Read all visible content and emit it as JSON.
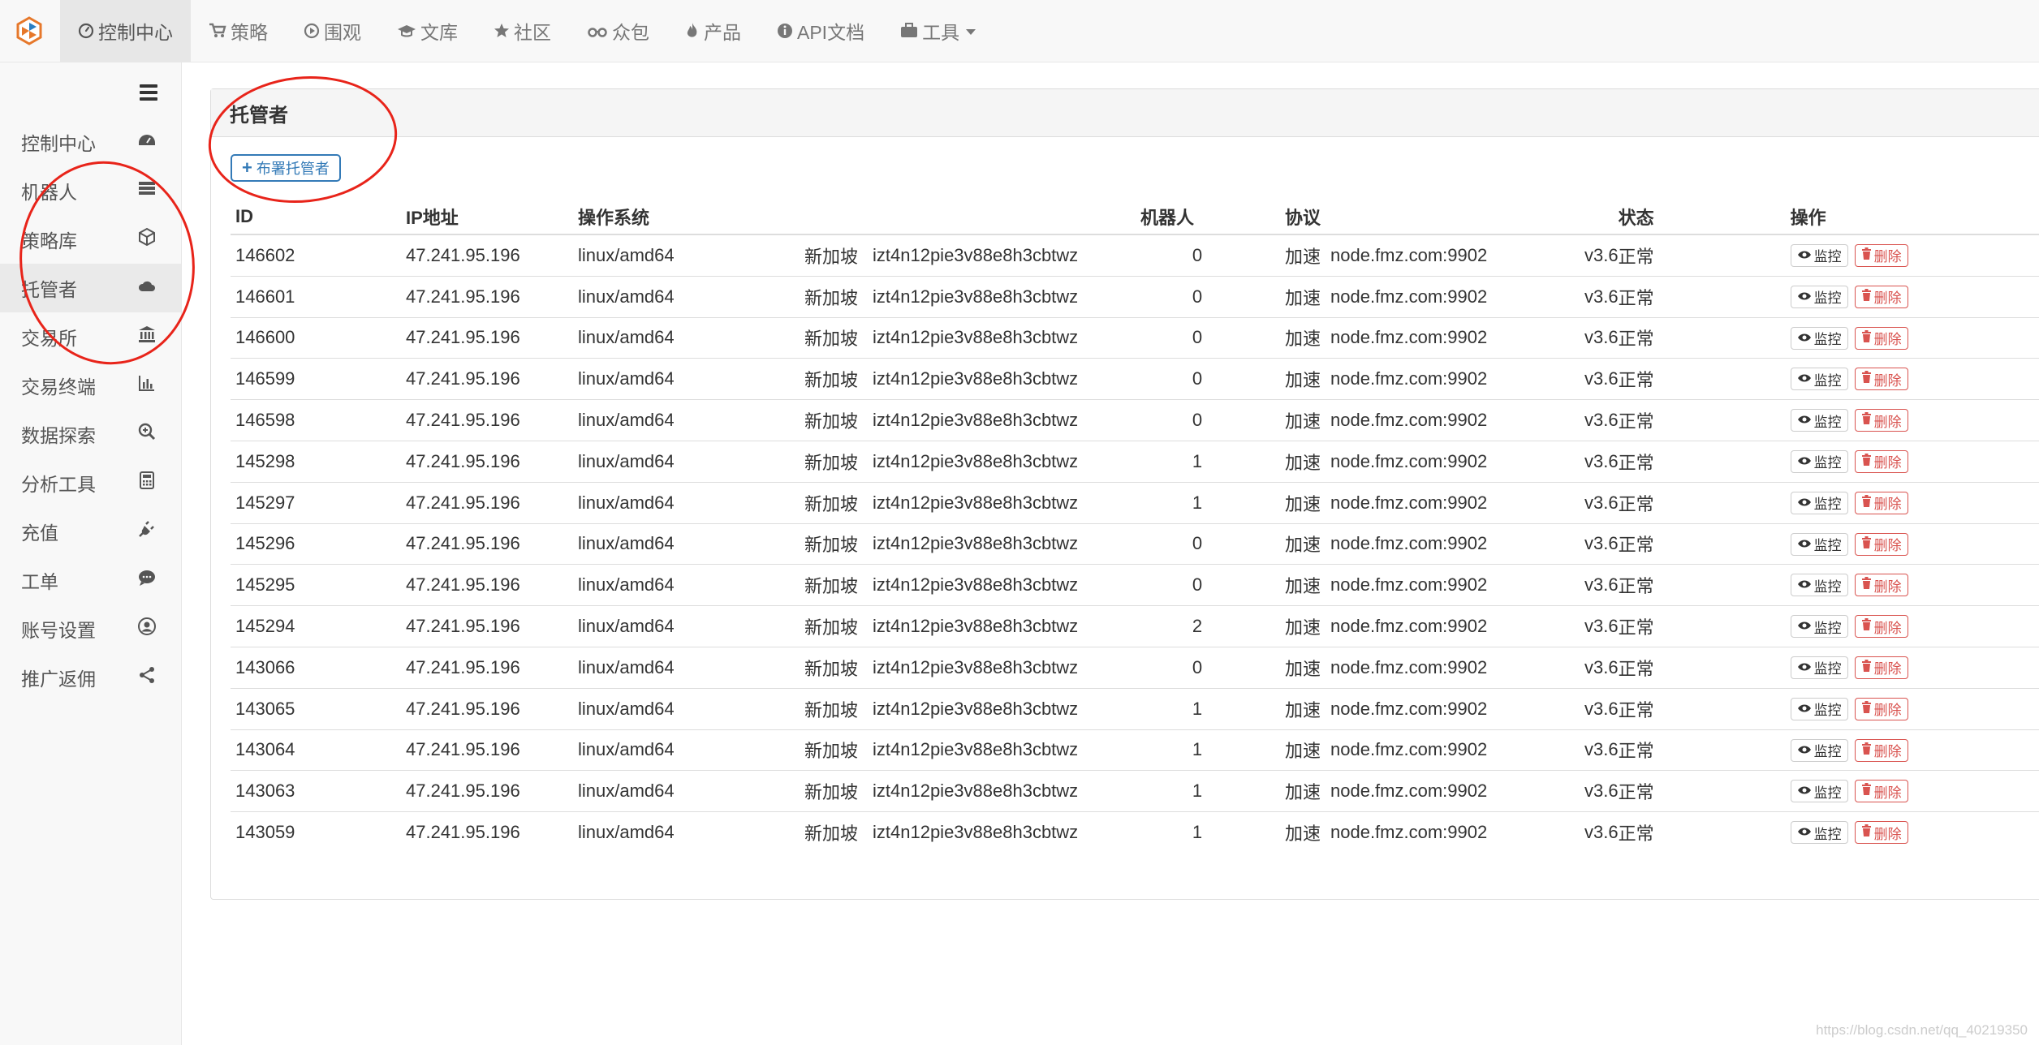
{
  "topnav": [
    {
      "label": "控制中心",
      "icon": "dashboard-icon",
      "active": true
    },
    {
      "label": "策略",
      "icon": "cart-icon"
    },
    {
      "label": "围观",
      "icon": "play-circle-icon"
    },
    {
      "label": "文库",
      "icon": "graduation-cap-icon"
    },
    {
      "label": "社区",
      "icon": "star-icon"
    },
    {
      "label": "众包",
      "icon": "glasses-icon"
    },
    {
      "label": "产品",
      "icon": "fire-icon"
    },
    {
      "label": "API文档",
      "icon": "info-circle-icon"
    },
    {
      "label": "工具",
      "icon": "briefcase-icon",
      "dropdown": true
    }
  ],
  "sidebar": {
    "items": [
      {
        "label": "控制中心",
        "icon": "dashboard-icon"
      },
      {
        "label": "机器人",
        "icon": "server-list-icon"
      },
      {
        "label": "策略库",
        "icon": "cube-icon"
      },
      {
        "label": "托管者",
        "icon": "cloud-icon",
        "active": true
      },
      {
        "label": "交易所",
        "icon": "bank-icon"
      },
      {
        "label": "交易终端",
        "icon": "bar-chart-icon"
      },
      {
        "label": "数据探索",
        "icon": "zoom-icon"
      },
      {
        "label": "分析工具",
        "icon": "calculator-icon"
      },
      {
        "label": "充值",
        "icon": "plug-icon"
      },
      {
        "label": "工单",
        "icon": "comment-icon"
      },
      {
        "label": "账号设置",
        "icon": "user-circle-icon"
      },
      {
        "label": "推广返佣",
        "icon": "share-icon"
      }
    ]
  },
  "panel": {
    "title": "托管者",
    "deploy_label": "布署托管者"
  },
  "table": {
    "headers": {
      "id": "ID",
      "ip": "IP地址",
      "os": "操作系统",
      "robots": "机器人",
      "protocol": "协议",
      "status": "状态",
      "ops": "操作"
    },
    "monitor_label": "监控",
    "delete_label": "删除",
    "rows": [
      {
        "id": "146602",
        "ip": "47.241.95.196",
        "os": "linux/amd64",
        "region": "新加坡",
        "key": "izt4n12pie3v88e8h3cbtwz",
        "robots": "0",
        "speed": "加速",
        "node": "node.fmz.com:9902",
        "ver": "v3.6",
        "status": "正常"
      },
      {
        "id": "146601",
        "ip": "47.241.95.196",
        "os": "linux/amd64",
        "region": "新加坡",
        "key": "izt4n12pie3v88e8h3cbtwz",
        "robots": "0",
        "speed": "加速",
        "node": "node.fmz.com:9902",
        "ver": "v3.6",
        "status": "正常"
      },
      {
        "id": "146600",
        "ip": "47.241.95.196",
        "os": "linux/amd64",
        "region": "新加坡",
        "key": "izt4n12pie3v88e8h3cbtwz",
        "robots": "0",
        "speed": "加速",
        "node": "node.fmz.com:9902",
        "ver": "v3.6",
        "status": "正常"
      },
      {
        "id": "146599",
        "ip": "47.241.95.196",
        "os": "linux/amd64",
        "region": "新加坡",
        "key": "izt4n12pie3v88e8h3cbtwz",
        "robots": "0",
        "speed": "加速",
        "node": "node.fmz.com:9902",
        "ver": "v3.6",
        "status": "正常"
      },
      {
        "id": "146598",
        "ip": "47.241.95.196",
        "os": "linux/amd64",
        "region": "新加坡",
        "key": "izt4n12pie3v88e8h3cbtwz",
        "robots": "0",
        "speed": "加速",
        "node": "node.fmz.com:9902",
        "ver": "v3.6",
        "status": "正常"
      },
      {
        "id": "145298",
        "ip": "47.241.95.196",
        "os": "linux/amd64",
        "region": "新加坡",
        "key": "izt4n12pie3v88e8h3cbtwz",
        "robots": "1",
        "speed": "加速",
        "node": "node.fmz.com:9902",
        "ver": "v3.6",
        "status": "正常"
      },
      {
        "id": "145297",
        "ip": "47.241.95.196",
        "os": "linux/amd64",
        "region": "新加坡",
        "key": "izt4n12pie3v88e8h3cbtwz",
        "robots": "1",
        "speed": "加速",
        "node": "node.fmz.com:9902",
        "ver": "v3.6",
        "status": "正常"
      },
      {
        "id": "145296",
        "ip": "47.241.95.196",
        "os": "linux/amd64",
        "region": "新加坡",
        "key": "izt4n12pie3v88e8h3cbtwz",
        "robots": "0",
        "speed": "加速",
        "node": "node.fmz.com:9902",
        "ver": "v3.6",
        "status": "正常"
      },
      {
        "id": "145295",
        "ip": "47.241.95.196",
        "os": "linux/amd64",
        "region": "新加坡",
        "key": "izt4n12pie3v88e8h3cbtwz",
        "robots": "0",
        "speed": "加速",
        "node": "node.fmz.com:9902",
        "ver": "v3.6",
        "status": "正常"
      },
      {
        "id": "145294",
        "ip": "47.241.95.196",
        "os": "linux/amd64",
        "region": "新加坡",
        "key": "izt4n12pie3v88e8h3cbtwz",
        "robots": "2",
        "speed": "加速",
        "node": "node.fmz.com:9902",
        "ver": "v3.6",
        "status": "正常"
      },
      {
        "id": "143066",
        "ip": "47.241.95.196",
        "os": "linux/amd64",
        "region": "新加坡",
        "key": "izt4n12pie3v88e8h3cbtwz",
        "robots": "0",
        "speed": "加速",
        "node": "node.fmz.com:9902",
        "ver": "v3.6",
        "status": "正常"
      },
      {
        "id": "143065",
        "ip": "47.241.95.196",
        "os": "linux/amd64",
        "region": "新加坡",
        "key": "izt4n12pie3v88e8h3cbtwz",
        "robots": "1",
        "speed": "加速",
        "node": "node.fmz.com:9902",
        "ver": "v3.6",
        "status": "正常"
      },
      {
        "id": "143064",
        "ip": "47.241.95.196",
        "os": "linux/amd64",
        "region": "新加坡",
        "key": "izt4n12pie3v88e8h3cbtwz",
        "robots": "1",
        "speed": "加速",
        "node": "node.fmz.com:9902",
        "ver": "v3.6",
        "status": "正常"
      },
      {
        "id": "143063",
        "ip": "47.241.95.196",
        "os": "linux/amd64",
        "region": "新加坡",
        "key": "izt4n12pie3v88e8h3cbtwz",
        "robots": "1",
        "speed": "加速",
        "node": "node.fmz.com:9902",
        "ver": "v3.6",
        "status": "正常"
      },
      {
        "id": "143059",
        "ip": "47.241.95.196",
        "os": "linux/amd64",
        "region": "新加坡",
        "key": "izt4n12pie3v88e8h3cbtwz",
        "robots": "1",
        "speed": "加速",
        "node": "node.fmz.com:9902",
        "ver": "v3.6",
        "status": "正常"
      }
    ]
  },
  "colors": {
    "accent": "#337ab7",
    "danger": "#d9534f",
    "annotation": "#e8241a"
  },
  "watermark": "https://blog.csdn.net/qq_40219350"
}
